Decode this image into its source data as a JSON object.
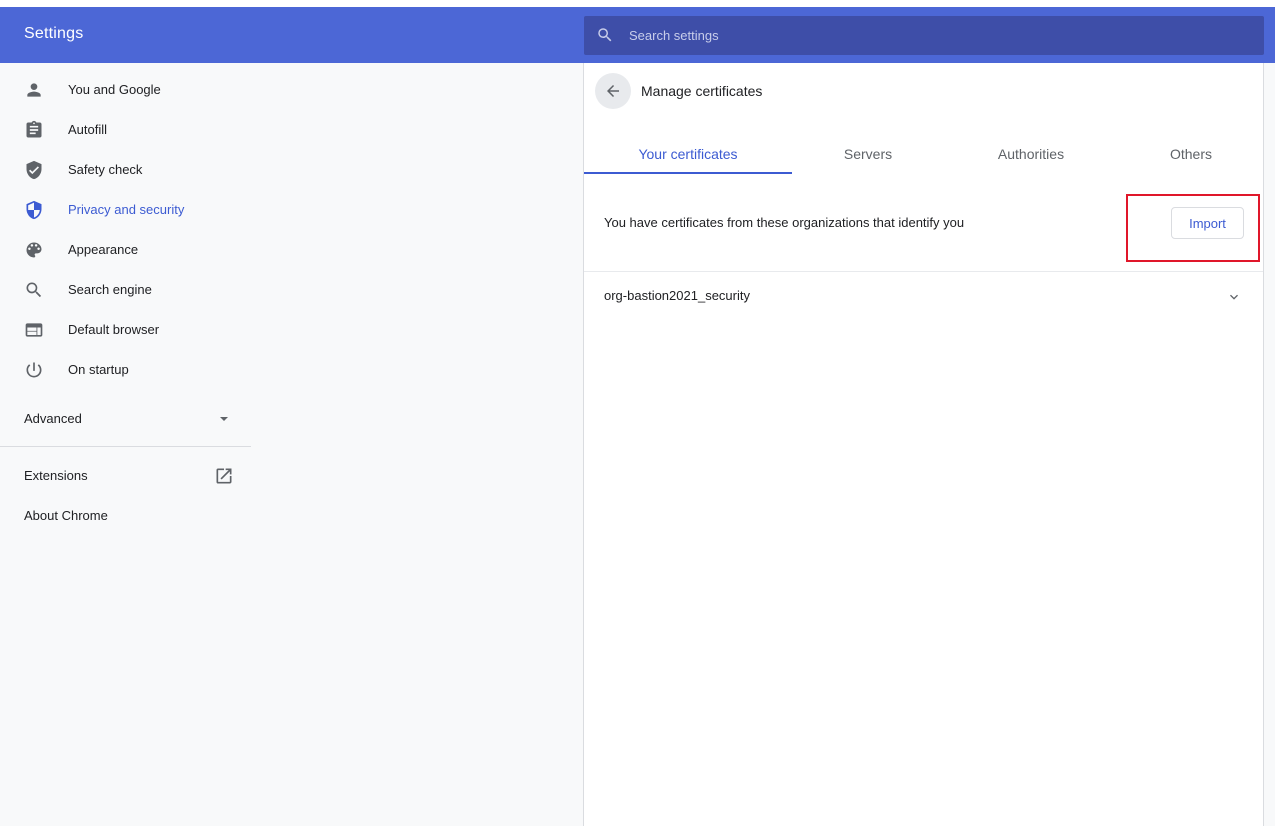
{
  "app": {
    "title": "Settings"
  },
  "search": {
    "placeholder": "Search settings"
  },
  "sidebar": {
    "items": [
      {
        "label": "You and Google",
        "icon": "person-icon"
      },
      {
        "label": "Autofill",
        "icon": "clipboard-icon"
      },
      {
        "label": "Safety check",
        "icon": "shield-check-icon"
      },
      {
        "label": "Privacy and security",
        "icon": "shield-icon",
        "active": true
      },
      {
        "label": "Appearance",
        "icon": "palette-icon"
      },
      {
        "label": "Search engine",
        "icon": "search-icon"
      },
      {
        "label": "Default browser",
        "icon": "browser-icon"
      },
      {
        "label": "On startup",
        "icon": "power-icon"
      }
    ],
    "advanced_label": "Advanced",
    "extensions_label": "Extensions",
    "about_label": "About Chrome"
  },
  "panel": {
    "title": "Manage certificates",
    "tabs": [
      "Your certificates",
      "Servers",
      "Authorities",
      "Others"
    ],
    "active_tab": 0,
    "intro": "You have certificates from these organizations that identify you",
    "import_label": "Import",
    "organizations": [
      "org-bastion2021_security"
    ]
  },
  "colors": {
    "header": "#4c67d6",
    "accent": "#3c5bd2",
    "highlight": "#e0172a"
  }
}
